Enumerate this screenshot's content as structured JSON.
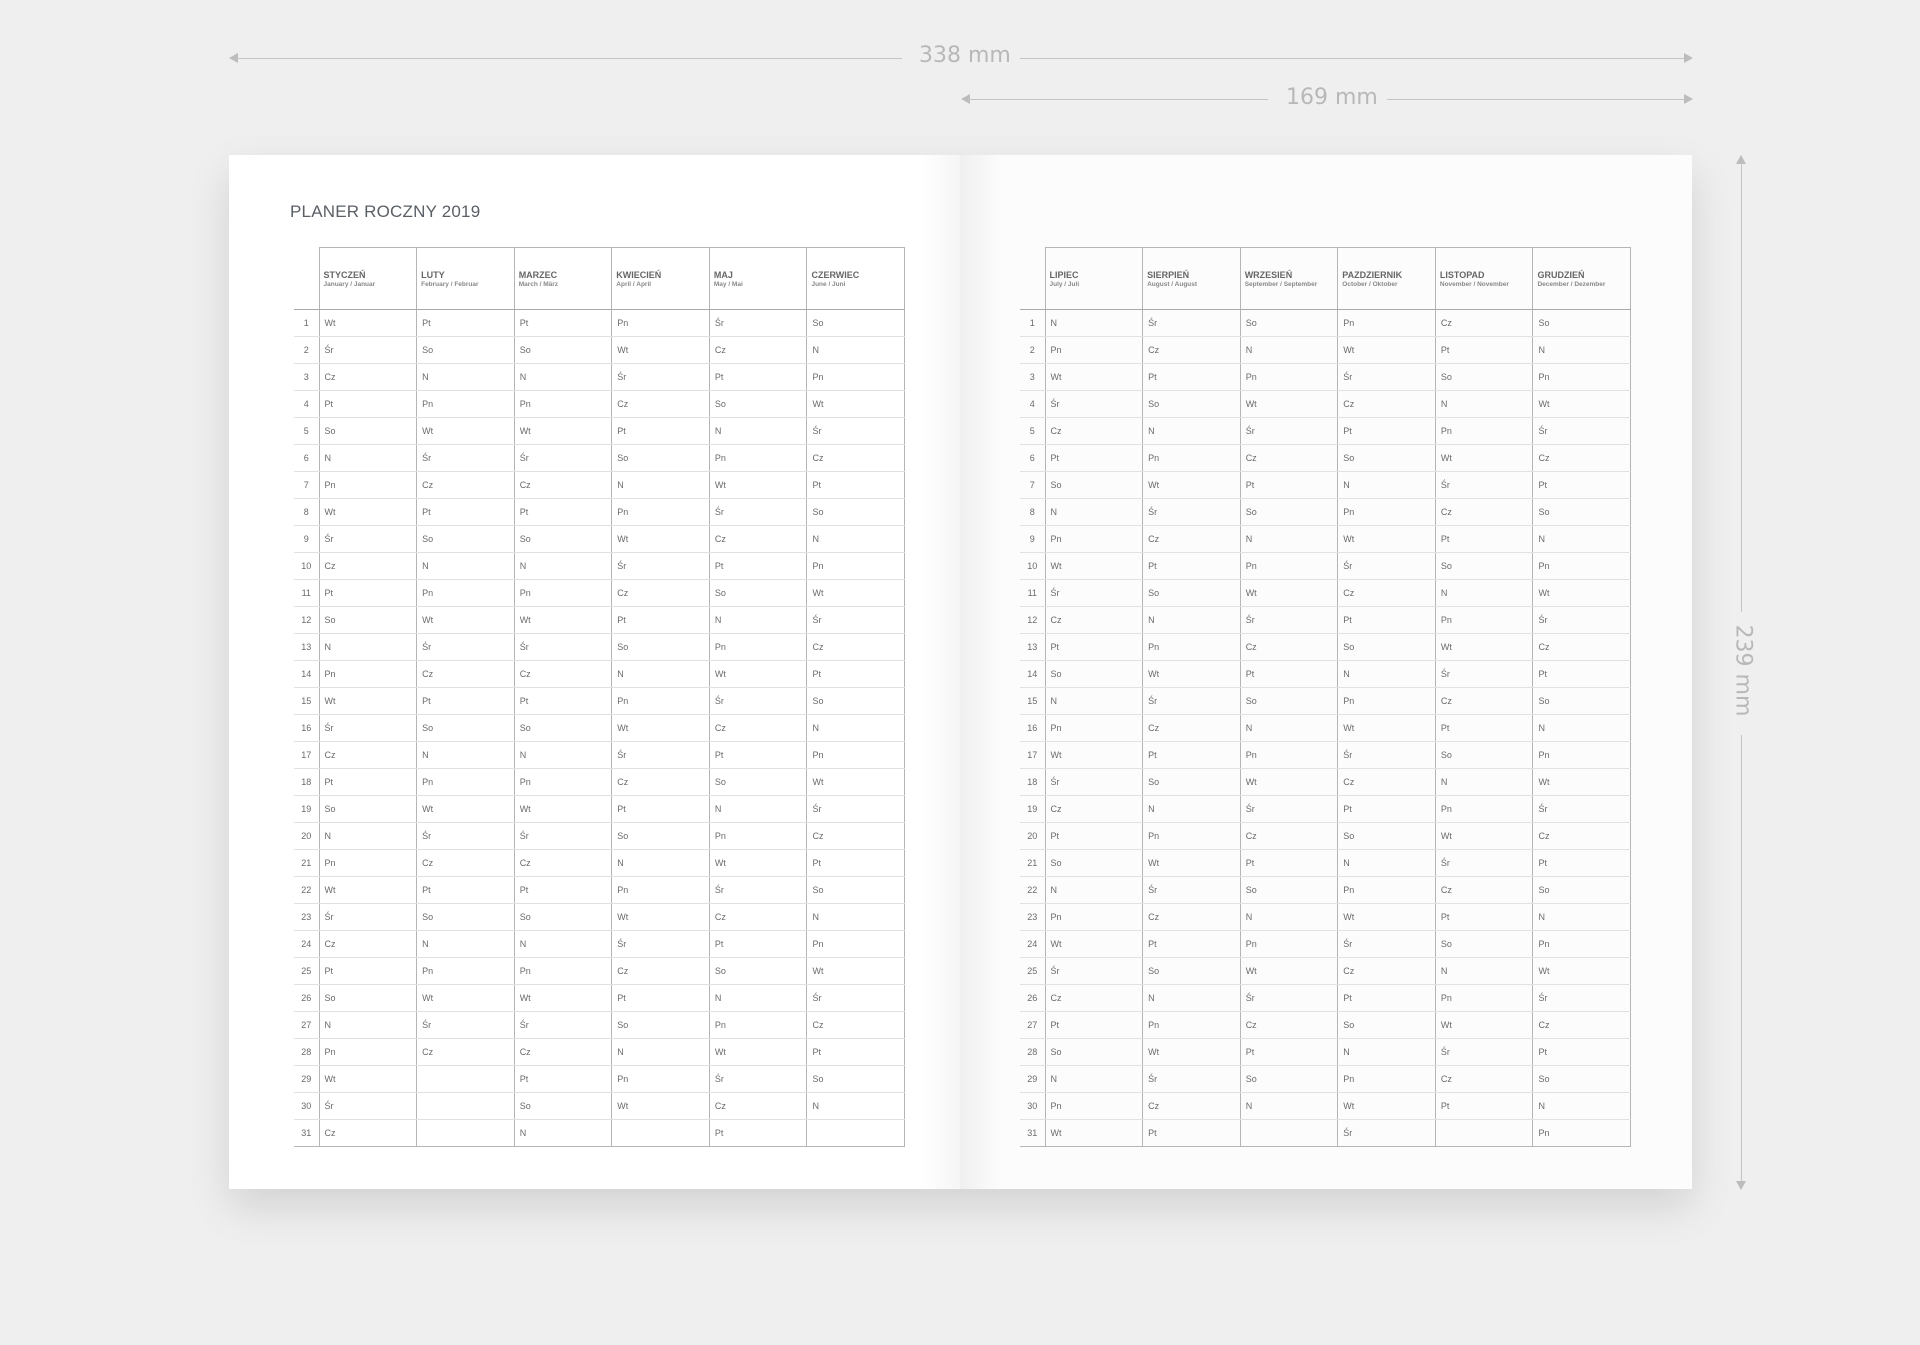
{
  "dimensions": {
    "width_label": "338 mm",
    "page_width_label": "169 mm",
    "height_label": "239 mm"
  },
  "planner": {
    "title": "PLANER ROCZNY 2019",
    "days": [
      "1",
      "2",
      "3",
      "4",
      "5",
      "6",
      "7",
      "8",
      "9",
      "10",
      "11",
      "12",
      "13",
      "14",
      "15",
      "16",
      "17",
      "18",
      "19",
      "20",
      "21",
      "22",
      "23",
      "24",
      "25",
      "26",
      "27",
      "28",
      "29",
      "30",
      "31"
    ],
    "left_months": [
      {
        "name": "STYCZEŃ",
        "sub": "January / Januar",
        "days": [
          "Wt",
          "Śr",
          "Cz",
          "Pt",
          "So",
          "N",
          "Pn",
          "Wt",
          "Śr",
          "Cz",
          "Pt",
          "So",
          "N",
          "Pn",
          "Wt",
          "Śr",
          "Cz",
          "Pt",
          "So",
          "N",
          "Pn",
          "Wt",
          "Śr",
          "Cz",
          "Pt",
          "So",
          "N",
          "Pn",
          "Wt",
          "Śr",
          "Cz"
        ]
      },
      {
        "name": "LUTY",
        "sub": "February / Februar",
        "days": [
          "Pt",
          "So",
          "N",
          "Pn",
          "Wt",
          "Śr",
          "Cz",
          "Pt",
          "So",
          "N",
          "Pn",
          "Wt",
          "Śr",
          "Cz",
          "Pt",
          "So",
          "N",
          "Pn",
          "Wt",
          "Śr",
          "Cz",
          "Pt",
          "So",
          "N",
          "Pn",
          "Wt",
          "Śr",
          "Cz",
          "",
          "",
          ""
        ]
      },
      {
        "name": "MARZEC",
        "sub": "March / März",
        "days": [
          "Pt",
          "So",
          "N",
          "Pn",
          "Wt",
          "Śr",
          "Cz",
          "Pt",
          "So",
          "N",
          "Pn",
          "Wt",
          "Śr",
          "Cz",
          "Pt",
          "So",
          "N",
          "Pn",
          "Wt",
          "Śr",
          "Cz",
          "Pt",
          "So",
          "N",
          "Pn",
          "Wt",
          "Śr",
          "Cz",
          "Pt",
          "So",
          "N"
        ]
      },
      {
        "name": "KWIECIEŃ",
        "sub": "April / April",
        "days": [
          "Pn",
          "Wt",
          "Śr",
          "Cz",
          "Pt",
          "So",
          "N",
          "Pn",
          "Wt",
          "Śr",
          "Cz",
          "Pt",
          "So",
          "N",
          "Pn",
          "Wt",
          "Śr",
          "Cz",
          "Pt",
          "So",
          "N",
          "Pn",
          "Wt",
          "Śr",
          "Cz",
          "Pt",
          "So",
          "N",
          "Pn",
          "Wt",
          ""
        ]
      },
      {
        "name": "MAJ",
        "sub": "May / Mai",
        "days": [
          "Śr",
          "Cz",
          "Pt",
          "So",
          "N",
          "Pn",
          "Wt",
          "Śr",
          "Cz",
          "Pt",
          "So",
          "N",
          "Pn",
          "Wt",
          "Śr",
          "Cz",
          "Pt",
          "So",
          "N",
          "Pn",
          "Wt",
          "Śr",
          "Cz",
          "Pt",
          "So",
          "N",
          "Pn",
          "Wt",
          "Śr",
          "Cz",
          "Pt"
        ]
      },
      {
        "name": "CZERWIEC",
        "sub": "June / Juni",
        "days": [
          "So",
          "N",
          "Pn",
          "Wt",
          "Śr",
          "Cz",
          "Pt",
          "So",
          "N",
          "Pn",
          "Wt",
          "Śr",
          "Cz",
          "Pt",
          "So",
          "N",
          "Pn",
          "Wt",
          "Śr",
          "Cz",
          "Pt",
          "So",
          "N",
          "Pn",
          "Wt",
          "Śr",
          "Cz",
          "Pt",
          "So",
          "N",
          ""
        ]
      }
    ],
    "right_months": [
      {
        "name": "LIPIEC",
        "sub": "July / Juli",
        "days": [
          "N",
          "Pn",
          "Wt",
          "Śr",
          "Cz",
          "Pt",
          "So",
          "N",
          "Pn",
          "Wt",
          "Śr",
          "Cz",
          "Pt",
          "So",
          "N",
          "Pn",
          "Wt",
          "Śr",
          "Cz",
          "Pt",
          "So",
          "N",
          "Pn",
          "Wt",
          "Śr",
          "Cz",
          "Pt",
          "So",
          "N",
          "Pn",
          "Wt"
        ]
      },
      {
        "name": "SIERPIEŃ",
        "sub": "August / August",
        "days": [
          "Śr",
          "Cz",
          "Pt",
          "So",
          "N",
          "Pn",
          "Wt",
          "Śr",
          "Cz",
          "Pt",
          "So",
          "N",
          "Pn",
          "Wt",
          "Śr",
          "Cz",
          "Pt",
          "So",
          "N",
          "Pn",
          "Wt",
          "Śr",
          "Cz",
          "Pt",
          "So",
          "N",
          "Pn",
          "Wt",
          "Śr",
          "Cz",
          "Pt"
        ]
      },
      {
        "name": "WRZESIEŃ",
        "sub": "September / September",
        "days": [
          "So",
          "N",
          "Pn",
          "Wt",
          "Śr",
          "Cz",
          "Pt",
          "So",
          "N",
          "Pn",
          "Wt",
          "Śr",
          "Cz",
          "Pt",
          "So",
          "N",
          "Pn",
          "Wt",
          "Śr",
          "Cz",
          "Pt",
          "So",
          "N",
          "Pn",
          "Wt",
          "Śr",
          "Cz",
          "Pt",
          "So",
          "N",
          ""
        ]
      },
      {
        "name": "PAZDZIERNIK",
        "sub": "October / Oktober",
        "days": [
          "Pn",
          "Wt",
          "Śr",
          "Cz",
          "Pt",
          "So",
          "N",
          "Pn",
          "Wt",
          "Śr",
          "Cz",
          "Pt",
          "So",
          "N",
          "Pn",
          "Wt",
          "Śr",
          "Cz",
          "Pt",
          "So",
          "N",
          "Pn",
          "Wt",
          "Śr",
          "Cz",
          "Pt",
          "So",
          "N",
          "Pn",
          "Wt",
          "Śr"
        ]
      },
      {
        "name": "LISTOPAD",
        "sub": "November / November",
        "days": [
          "Cz",
          "Pt",
          "So",
          "N",
          "Pn",
          "Wt",
          "Śr",
          "Cz",
          "Pt",
          "So",
          "N",
          "Pn",
          "Wt",
          "Śr",
          "Cz",
          "Pt",
          "So",
          "N",
          "Pn",
          "Wt",
          "Śr",
          "Cz",
          "Pt",
          "So",
          "N",
          "Pn",
          "Wt",
          "Śr",
          "Cz",
          "Pt",
          ""
        ]
      },
      {
        "name": "GRUDZIEŃ",
        "sub": "December / Dezember",
        "days": [
          "So",
          "N",
          "Pn",
          "Wt",
          "Śr",
          "Cz",
          "Pt",
          "So",
          "N",
          "Pn",
          "Wt",
          "Śr",
          "Cz",
          "Pt",
          "So",
          "N",
          "Pn",
          "Wt",
          "Śr",
          "Cz",
          "Pt",
          "So",
          "N",
          "Pn",
          "Wt",
          "Śr",
          "Cz",
          "Pt",
          "So",
          "N",
          "Pn"
        ]
      }
    ]
  }
}
